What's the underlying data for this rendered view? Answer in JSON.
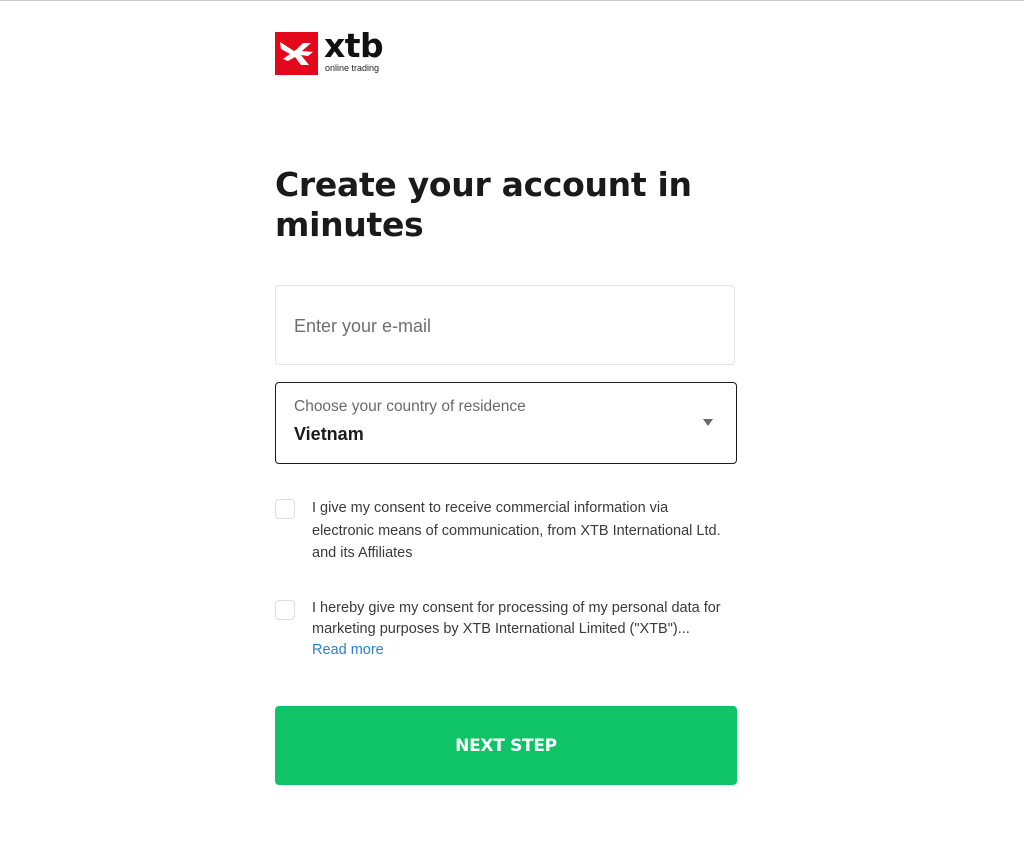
{
  "brand": {
    "name": "xtb",
    "tagline": "online trading",
    "logo_color": "#e2071a"
  },
  "form": {
    "title": "Create your account in minutes",
    "email": {
      "placeholder": "Enter your e-mail",
      "value": ""
    },
    "country": {
      "label": "Choose your country of residence",
      "selected": "Vietnam"
    },
    "consents": [
      {
        "text": "I give my consent to receive commercial information via electronic means of communication, from XTB International Ltd. and its Affiliates",
        "checked": false
      },
      {
        "text": "I hereby give my consent for processing of my personal data for marketing purposes by XTB International Limited (\"XTB\")...",
        "link_label": "Read more",
        "checked": false
      }
    ],
    "submit_label": "NEXT STEP",
    "submit_color": "#0ec467",
    "link_color": "#2f80c9"
  }
}
